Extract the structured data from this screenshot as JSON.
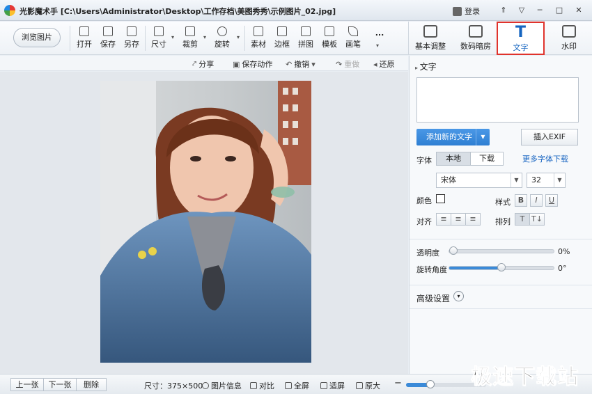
{
  "window": {
    "title": "光影魔术手 [C:\\Users\\Administrator\\Desktop\\工作存档\\美图秀秀\\示例图片_02.jpg]",
    "login": "登录",
    "buttons": [
      "⇑",
      "▽",
      "─",
      "□",
      "✕"
    ]
  },
  "toolbar": {
    "browse": "浏览图片",
    "tools": [
      {
        "label": "打开",
        "icon": "open-icon"
      },
      {
        "label": "保存",
        "icon": "save-icon"
      },
      {
        "label": "另存",
        "icon": "save-as-icon"
      },
      {
        "label": "尺寸",
        "icon": "resize-icon"
      },
      {
        "label": "裁剪",
        "icon": "crop-icon"
      },
      {
        "label": "旋转",
        "icon": "rotate-icon"
      },
      {
        "label": "素材",
        "icon": "material-icon"
      },
      {
        "label": "边框",
        "icon": "border-icon"
      },
      {
        "label": "拼图",
        "icon": "collage-icon"
      },
      {
        "label": "模板",
        "icon": "template-icon"
      },
      {
        "label": "画笔",
        "icon": "brush-icon"
      },
      {
        "label": "...",
        "icon": "more-icon"
      }
    ]
  },
  "right_tabs": [
    {
      "label": "基本调整",
      "icon": "adjust-icon",
      "active": false
    },
    {
      "label": "数码暗房",
      "icon": "darkroom-icon",
      "active": false
    },
    {
      "label": "文字",
      "icon": "text-icon",
      "active": true,
      "glyph": "T"
    },
    {
      "label": "水印",
      "icon": "watermark-icon",
      "active": false
    }
  ],
  "actions": {
    "share": "分享",
    "save_action": "保存动作",
    "undo": "撤销",
    "redo": "重做",
    "restore": "还原"
  },
  "text_panel": {
    "section": "文字",
    "add_text": "添加新的文字",
    "insert_exif": "插入EXIF",
    "font_label": "字体",
    "local": "本地",
    "download": "下载",
    "more_fonts": "更多字体下载",
    "font_value": "宋体",
    "size_value": "32",
    "color_label": "颜色",
    "style_label": "样式",
    "bold": "B",
    "italic": "I",
    "underline": "U",
    "align_label": "对齐",
    "arrange_label": "排列",
    "opacity_label": "透明度",
    "opacity_value": "0%",
    "opacity": 0,
    "rotation_label": "旋转角度",
    "rotation_value": "0°",
    "rotation": 0.5,
    "advanced": "高级设置"
  },
  "statusbar": {
    "prev": "上一张",
    "next": "下一张",
    "delete": "删除",
    "size": "尺寸：375×500",
    "info": "图片信息",
    "compare": "对比",
    "fullscreen": "全屏",
    "fit": "适屏",
    "original": "原大",
    "zoom": 0.3
  },
  "watermark_text": "极速下载站",
  "colors": {
    "accent": "#3b8ad8",
    "active_border": "#e0332c"
  }
}
